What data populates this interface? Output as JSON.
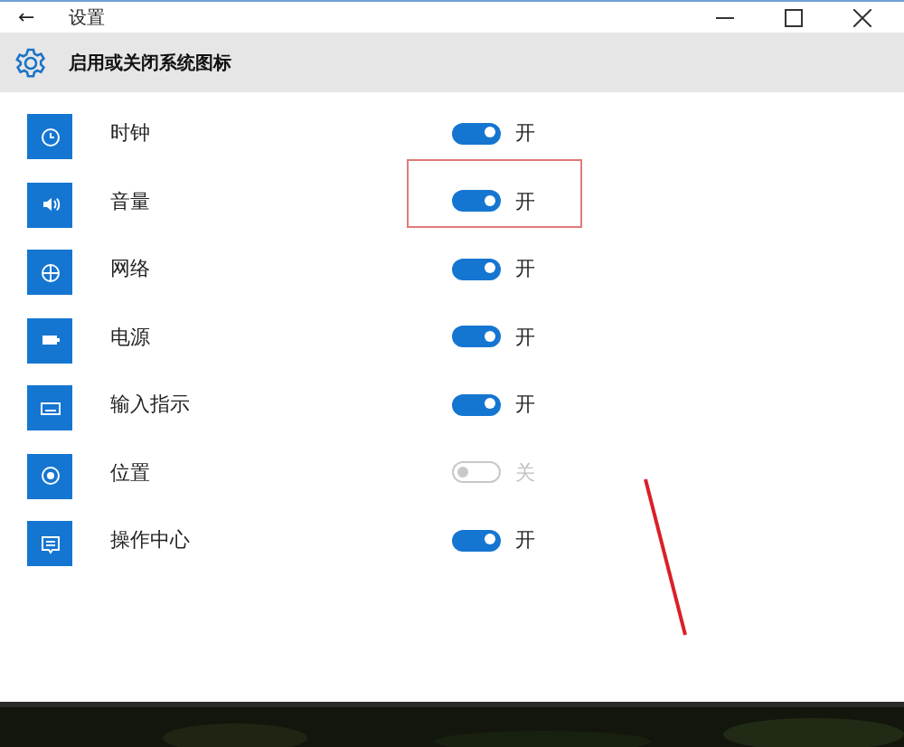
{
  "window": {
    "title": "设置",
    "back": "←"
  },
  "header": {
    "title": "启用或关闭系统图标"
  },
  "items": [
    {
      "kind": "clock",
      "label": "时钟",
      "on": true,
      "state_text": "开",
      "highlighted": false
    },
    {
      "kind": "volume",
      "label": "音量",
      "on": true,
      "state_text": "开",
      "highlighted": true
    },
    {
      "kind": "network",
      "label": "网络",
      "on": true,
      "state_text": "开",
      "highlighted": false
    },
    {
      "kind": "power",
      "label": "电源",
      "on": true,
      "state_text": "开",
      "highlighted": false
    },
    {
      "kind": "input",
      "label": "输入指示",
      "on": true,
      "state_text": "开",
      "highlighted": false
    },
    {
      "kind": "location",
      "label": "位置",
      "on": false,
      "state_text": "关",
      "highlighted": false
    },
    {
      "kind": "action",
      "label": "操作中心",
      "on": true,
      "state_text": "开",
      "highlighted": false
    }
  ]
}
